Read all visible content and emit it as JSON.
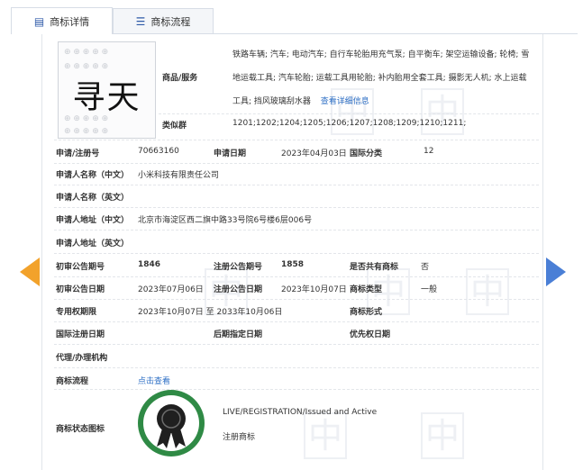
{
  "tabs": [
    {
      "label": "商标详情",
      "icon": "document-icon"
    },
    {
      "label": "商标流程",
      "icon": "list-icon"
    }
  ],
  "logo": {
    "text": "寻天"
  },
  "goods": {
    "label": "商品/服务",
    "text": "铁路车辆; 汽车; 电动汽车; 自行车轮胎用充气泵; 自平衡车; 架空运输设备; 轮椅; 雪地运载工具; 汽车轮胎; 运载工具用轮胎; 补内胎用全套工具; 摄影无人机; 水上运载工具; 挡风玻璃刮水器",
    "more_link": "查看详细信息"
  },
  "similar_group": {
    "label": "类似群",
    "value": "1201;1202;1204;1205;1206;1207;1208;1209;1210;1211;"
  },
  "fields": {
    "reg_no_label": "申请/注册号",
    "reg_no": "70663160",
    "apply_date_label": "申请日期",
    "apply_date": "2023年04月03日",
    "intl_class_label": "国际分类",
    "intl_class": "12",
    "applicant_cn_label": "申请人名称（中文）",
    "applicant_cn": "小米科技有限责任公司",
    "applicant_en_label": "申请人名称（英文）",
    "applicant_en": "",
    "address_cn_label": "申请人地址（中文）",
    "address_cn": "北京市海淀区西二旗中路33号院6号楼6层006号",
    "address_en_label": "申请人地址（英文）",
    "address_en": "",
    "prelim_no_label": "初审公告期号",
    "prelim_no": "1846",
    "reg_notice_no_label": "注册公告期号",
    "reg_notice_no": "1858",
    "shared_label": "是否共有商标",
    "shared": "否",
    "prelim_date_label": "初审公告日期",
    "prelim_date": "2023年07月06日",
    "reg_notice_date_label": "注册公告日期",
    "reg_notice_date": "2023年10月07日",
    "tm_type_label": "商标类型",
    "tm_type": "一般",
    "exclusive_label": "专用权期限",
    "exclusive_period": "2023年10月07日 至 2033年10月06日",
    "tm_form_label": "商标形式",
    "tm_form": "",
    "intl_reg_date_label": "国际注册日期",
    "intl_reg_date": "",
    "later_date_label": "后期指定日期",
    "later_date": "",
    "priority_label": "优先权日期",
    "priority_date": "",
    "agent_label": "代理/办理机构",
    "agent": "",
    "process_label": "商标流程",
    "process_link": "点击查看",
    "status_label": "商标状态图标",
    "status_en": "LIVE/REGISTRATION/Issued and Active",
    "status_cn": "注册商标"
  },
  "watermark_char": "中",
  "colors": {
    "accent": "#2e6fc5",
    "arrow_left": "#f2a22b",
    "arrow_right": "#4a7fd6",
    "badge_green": "#2f8a45"
  }
}
